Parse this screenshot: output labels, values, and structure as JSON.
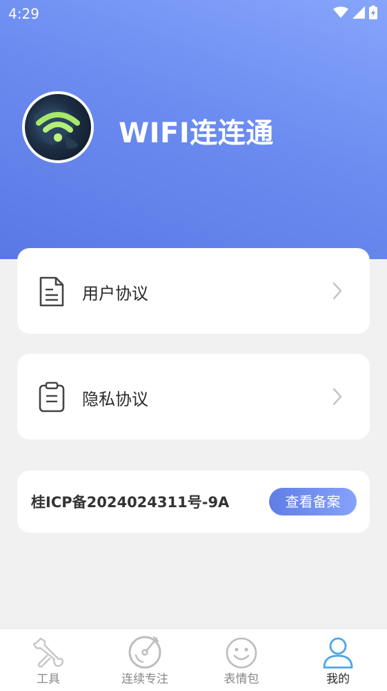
{
  "status_bar": {
    "time": "4:29",
    "icons": [
      "wifi-icon",
      "signal-icon",
      "battery-charging-icon"
    ]
  },
  "profile": {
    "app_name": "WIFI连连通",
    "avatar": "wifi-logo-avatar"
  },
  "menu": [
    {
      "label": "用户协议",
      "icon": "document-icon"
    },
    {
      "label": "隐私协议",
      "icon": "clipboard-icon"
    }
  ],
  "icp": {
    "text": "桂ICP备2024024311号-9A",
    "button_label": "查看备案"
  },
  "tabs": [
    {
      "label": "工具",
      "icon": "wrench-icon",
      "active": false
    },
    {
      "label": "连续专注",
      "icon": "focus-dial-icon",
      "active": false
    },
    {
      "label": "表情包",
      "icon": "smiley-icon",
      "active": false
    },
    {
      "label": "我的",
      "icon": "user-icon",
      "active": true
    }
  ],
  "colors": {
    "accent": "#6b8bf0",
    "tab_active": "#4aa6e8",
    "tab_inactive": "#b0b0b0"
  }
}
